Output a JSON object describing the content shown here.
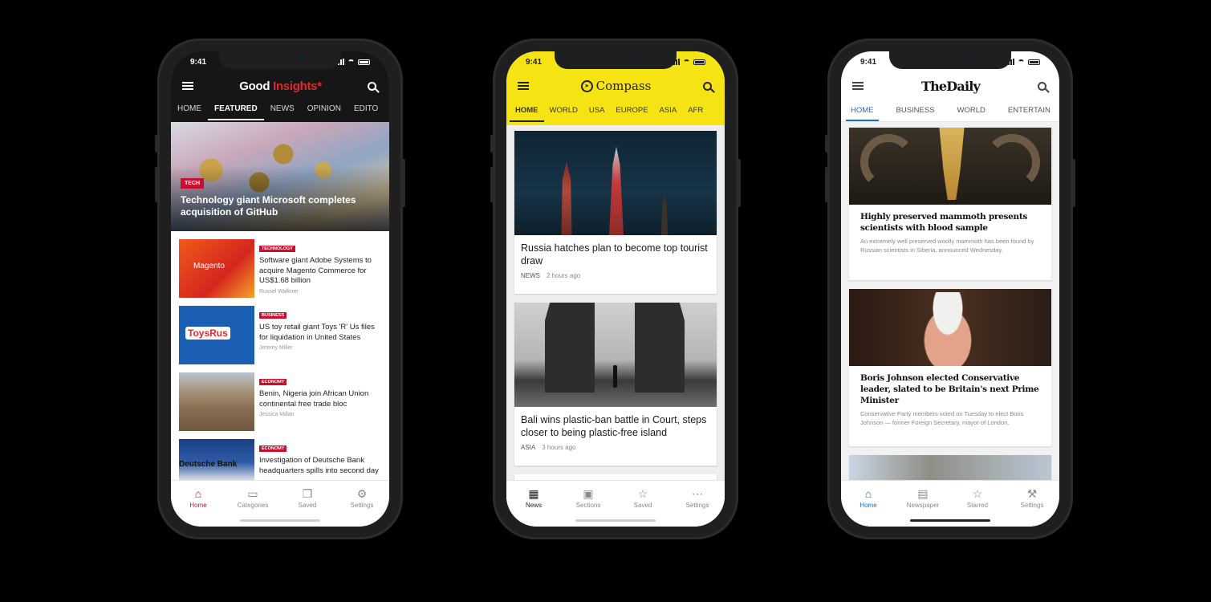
{
  "phones": [
    {
      "status": {
        "time": "9:41"
      },
      "brand": {
        "part1": "Good ",
        "part2": "Insights",
        "mark": "*"
      },
      "tabs": [
        "HOME",
        "FEATURED",
        "NEWS",
        "OPINION",
        "EDITO"
      ],
      "active_tab": "FEATURED",
      "hero": {
        "tag": "TECH",
        "title": "Technology giant Microsoft completes acquisition of GitHub"
      },
      "articles": [
        {
          "category": "TECHNOLOGY",
          "headline": "Software giant Adobe Systems to acquire Magento Commerce for US$1.68 billion",
          "author": "Russel Walkner",
          "thumb_label": "Magento"
        },
        {
          "category": "BUSINESS",
          "headline": "US toy retail giant Toys 'R' Us files for liquidation in United States",
          "author": "Jeremy Miller",
          "thumb_label": "ToysRus"
        },
        {
          "category": "ECONOMY",
          "headline": "Benin, Nigeria join African Union continental free trade bloc",
          "author": "Jessica Millan",
          "thumb_label": ""
        },
        {
          "category": "ECONOMY",
          "headline": "Investigation of Deutsche Bank headquarters spills into second day",
          "author": "",
          "thumb_label": "Deutsche Bank"
        }
      ],
      "nav": [
        "Home",
        "Categories",
        "Saved",
        "Settings"
      ],
      "active_nav": "Home"
    },
    {
      "status": {
        "time": "9:41"
      },
      "brand": {
        "name": "Compass"
      },
      "tabs": [
        "HOME",
        "WORLD",
        "USA",
        "EUROPE",
        "ASIA",
        "AFR"
      ],
      "active_tab": "HOME",
      "cards": [
        {
          "headline": "Russia hatches plan to become top tourist draw",
          "section": "NEWS",
          "time": "2 hours ago"
        },
        {
          "headline": "Bali wins plastic-ban battle in Court, steps closer to being plastic-free island",
          "section": "ASIA",
          "time": "3 hours ago"
        }
      ],
      "nav": [
        "News",
        "Sections",
        "Saved",
        "Settings"
      ],
      "active_nav": "News"
    },
    {
      "status": {
        "time": "9:41"
      },
      "brand": {
        "name": "TheDaily"
      },
      "tabs": [
        "HOME",
        "BUSINESS",
        "WORLD",
        "ENTERTAIN"
      ],
      "active_tab": "HOME",
      "cards": [
        {
          "headline": "Highly preserved mammoth presents scientists with blood sample",
          "summary": "An extremely well preserved woolly mammoth has been found by Russian scientists in Siberia, announced Wednesday."
        },
        {
          "headline": "Boris Johnson elected Conservative leader, slated to be Britain's next Prime Minister",
          "summary": "Conservative Party members voted on Tuesday to elect Boris Johnson — former Foreign Secretary, mayor of London."
        }
      ],
      "nav": [
        "Home",
        "Newspaper",
        "Starred",
        "Settings"
      ],
      "active_nav": "Home"
    }
  ],
  "colors": {
    "good_insights_red": "#c8102e",
    "compass_yellow": "#f5e313",
    "daily_blue": "#1b6fc6"
  }
}
